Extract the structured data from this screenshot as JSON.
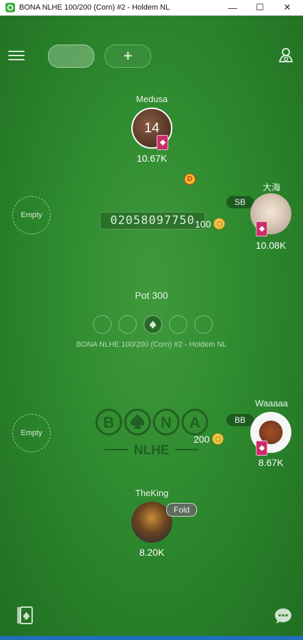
{
  "window": {
    "title": "BONA NLHE 100/200 (Corn) #2 - Holdem NL",
    "minimize": "—",
    "maximize": "☐",
    "close": "✕"
  },
  "toolbar": {
    "add_label": "+"
  },
  "players": {
    "top": {
      "name": "Medusa",
      "chips": "10.67K",
      "timer": "14"
    },
    "right_upper": {
      "name": "大海",
      "chips": "10.08K",
      "position": "SB",
      "bet": "100"
    },
    "right_lower": {
      "name": "Waaaaa",
      "chips": "8.67K",
      "position": "BB",
      "bet": "200"
    },
    "bottom": {
      "name": "TheKing",
      "chips": "8.20K",
      "action": "Fold"
    }
  },
  "empty_seats": {
    "left_upper": "Empty",
    "left_lower": "Empty"
  },
  "dealer_button": "D",
  "hand_number": "02058097750",
  "pot": "Pot 300",
  "table_name": "BONA NLHE 100/200 (Corn) #2 - Holdem NL",
  "logo": {
    "brand": "BONA",
    "game": "NLHE"
  },
  "colors": {
    "felt": "#2e8a2e",
    "card_badge": "#c8306a",
    "coin": "#efc74a",
    "fold_badge": "#5e6b5e"
  },
  "icons": [
    "menu-icon",
    "settings-icon",
    "card-icon",
    "coin-icon",
    "chat-icon",
    "plus-icon"
  ]
}
